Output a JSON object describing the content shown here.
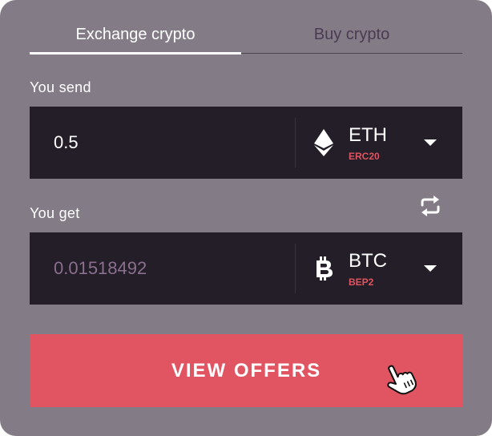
{
  "tabs": [
    {
      "label": "Exchange crypto",
      "active": true
    },
    {
      "label": "Buy crypto",
      "active": false
    }
  ],
  "send": {
    "label": "You  send",
    "amount": "0.5",
    "currency": {
      "ticker": "ETH",
      "network": "ERC20",
      "icon": "ethereum-icon"
    }
  },
  "get": {
    "label": "You  get",
    "amount": "0.01518492",
    "currency": {
      "ticker": "BTC",
      "network": "BEP2",
      "icon": "bitcoin-icon"
    }
  },
  "swap_icon": "swap-arrows-icon",
  "cta": {
    "label": "VIEW OFFERS"
  },
  "cursor_icon": "hand-pointer-icon",
  "colors": {
    "panel": "#837c86",
    "field": "#231e28",
    "accent": "#e05561",
    "muted_text": "#8a6f8e"
  }
}
